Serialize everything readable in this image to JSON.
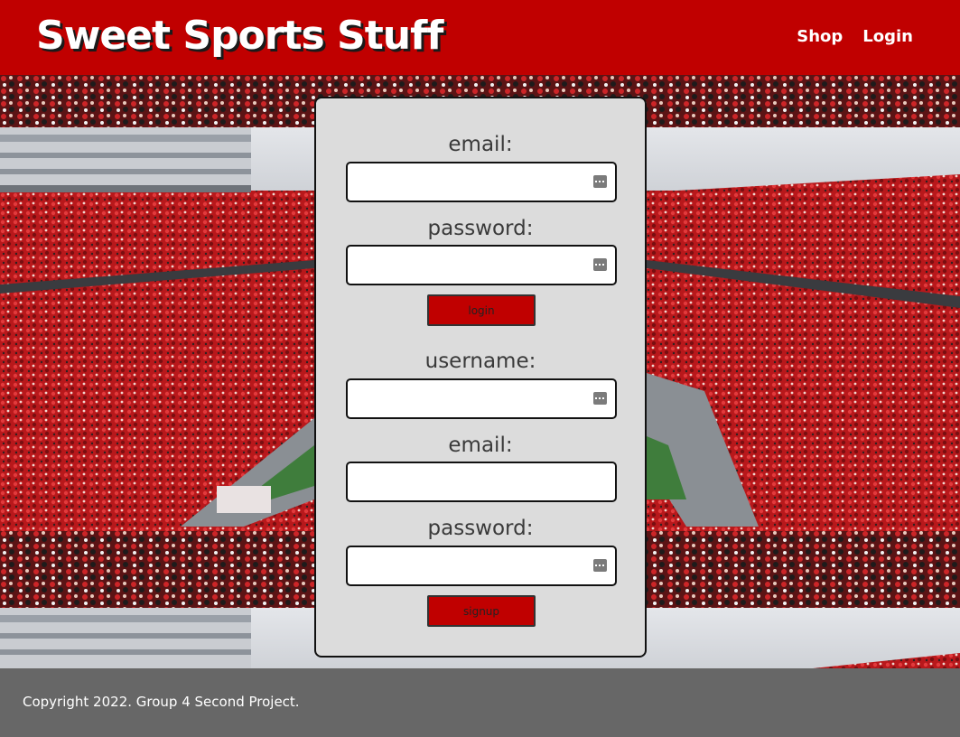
{
  "header": {
    "brand": "Sweet Sports Stuff",
    "nav": {
      "shop": "Shop",
      "login": "Login"
    }
  },
  "login_form": {
    "email_label": "email:",
    "password_label": "password:",
    "submit_label": "login"
  },
  "signup_form": {
    "username_label": "username:",
    "email_label": "email:",
    "password_label": "password:",
    "submit_label": "signup"
  },
  "footer": {
    "copyright": "Copyright 2022. Group 4 Second Project."
  },
  "colors": {
    "brand_red": "#c00000",
    "card_bg": "#dcdcdc",
    "footer_bg": "#676767"
  }
}
